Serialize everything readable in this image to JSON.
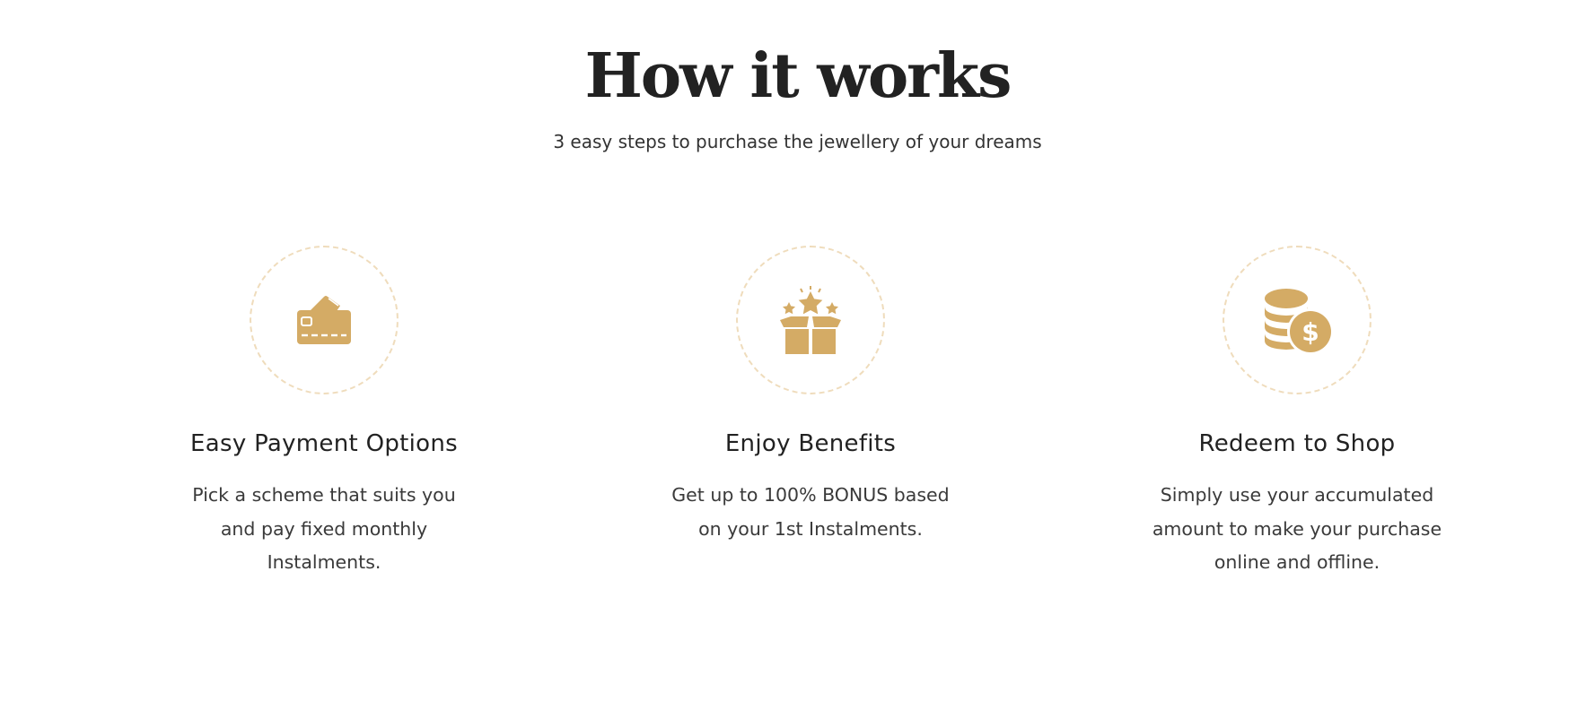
{
  "header": {
    "title": "How it works",
    "subtitle": "3 easy steps to purchase the jewellery of your dreams"
  },
  "steps": [
    {
      "icon": "credit-card-icon",
      "title": "Easy Payment Options",
      "description": "Pick a scheme that suits you and pay fixed monthly Instalments."
    },
    {
      "icon": "gift-box-stars-icon",
      "title": "Enjoy Benefits",
      "description": "Get up to 100% BONUS based on your 1st Instalments."
    },
    {
      "icon": "coins-dollar-icon",
      "title": "Redeem to Shop",
      "description": "Simply use your accumulated amount to make your purchase online and offline."
    }
  ],
  "colors": {
    "accent_gold": "#d4ab65",
    "ring_dashed": "#efdcbc",
    "text_dark": "#222222"
  }
}
